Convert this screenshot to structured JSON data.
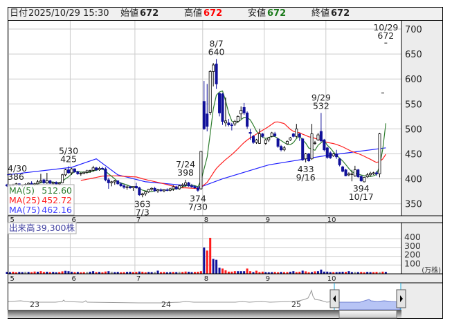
{
  "header": {
    "date_label": "日付",
    "date_value": "2025/10/29 15:30",
    "open_label": "始値",
    "open_value": "672",
    "high_label": "高値",
    "high_value": "672",
    "low_label": "安値",
    "low_value": "672",
    "close_label": "終値",
    "close_value": "672"
  },
  "legend": {
    "ma5_label": "MA(5)",
    "ma5_value": "512.60",
    "ma25_label": "MA(25)",
    "ma25_value": "452.72",
    "ma75_label": "MA(75)",
    "ma75_value": "462.16",
    "volume_label": "出来高",
    "volume_value": "39,300株"
  },
  "colors": {
    "up_fill": "#ffffff",
    "down_fill": "#10109a",
    "ma5": "#2e7d2e",
    "ma25": "#ff2020",
    "ma75": "#2020ff",
    "vol_red": "#ff1a1a",
    "vol_blue": "#10109a",
    "vol_gray": "#999999",
    "high_value": "#ff0000",
    "low_value": "#1a7a1a"
  },
  "navigator": {
    "year_labels": [
      "23",
      "24",
      "25"
    ]
  },
  "chart_data": {
    "type": "candlestick",
    "title": "",
    "price_axis": {
      "ylim": [
        330,
        720
      ],
      "ticks": [
        700,
        650,
        600,
        550,
        500,
        450,
        400,
        350
      ]
    },
    "month_ticks": [
      {
        "label": "5",
        "index": 1
      },
      {
        "label": "6",
        "index": 21
      },
      {
        "label": "7",
        "index": 42
      },
      {
        "label": "8",
        "index": 64
      },
      {
        "label": "9",
        "index": 84
      },
      {
        "label": "10",
        "index": 104
      }
    ],
    "ohlc": [
      [
        388,
        390,
        384,
        386
      ],
      [
        386,
        389,
        383,
        387
      ],
      [
        387,
        390,
        385,
        388
      ],
      [
        388,
        392,
        386,
        390
      ],
      [
        390,
        391,
        386,
        387
      ],
      [
        387,
        389,
        384,
        388
      ],
      [
        388,
        391,
        385,
        389
      ],
      [
        389,
        393,
        387,
        391
      ],
      [
        391,
        395,
        388,
        389
      ],
      [
        389,
        392,
        386,
        390
      ],
      [
        390,
        398,
        388,
        394
      ],
      [
        394,
        410,
        392,
        396
      ],
      [
        398,
        400,
        390,
        392
      ],
      [
        392,
        412,
        390,
        396
      ],
      [
        396,
        398,
        390,
        391
      ],
      [
        391,
        394,
        388,
        393
      ],
      [
        393,
        395,
        389,
        390
      ],
      [
        390,
        393,
        387,
        392
      ],
      [
        392,
        410,
        391,
        408
      ],
      [
        408,
        420,
        405,
        418
      ],
      [
        418,
        425,
        410,
        412
      ],
      [
        412,
        422,
        408,
        420
      ],
      [
        420,
        421,
        412,
        414
      ],
      [
        414,
        416,
        408,
        410
      ],
      [
        410,
        413,
        406,
        411
      ],
      [
        411,
        415,
        409,
        413
      ],
      [
        413,
        418,
        410,
        416
      ],
      [
        416,
        418,
        412,
        417
      ],
      [
        417,
        426,
        414,
        422
      ],
      [
        422,
        424,
        416,
        418
      ],
      [
        418,
        424,
        416,
        421
      ],
      [
        421,
        424,
        418,
        420
      ],
      [
        420,
        423,
        395,
        398
      ],
      [
        398,
        402,
        380,
        392
      ],
      [
        392,
        396,
        385,
        394
      ],
      [
        394,
        398,
        388,
        396
      ],
      [
        396,
        397,
        388,
        390
      ],
      [
        390,
        393,
        384,
        386
      ],
      [
        386,
        389,
        380,
        383
      ],
      [
        383,
        387,
        378,
        384
      ],
      [
        384,
        386,
        380,
        382
      ],
      [
        382,
        385,
        376,
        385
      ],
      [
        385,
        392,
        380,
        382
      ],
      [
        382,
        384,
        366,
        368
      ],
      [
        368,
        372,
        363,
        370
      ],
      [
        370,
        376,
        366,
        374
      ],
      [
        374,
        380,
        372,
        379
      ],
      [
        379,
        383,
        376,
        381
      ],
      [
        381,
        384,
        374,
        376
      ],
      [
        376,
        380,
        372,
        378
      ],
      [
        378,
        381,
        374,
        376
      ],
      [
        376,
        379,
        373,
        378
      ],
      [
        378,
        381,
        375,
        377
      ],
      [
        377,
        382,
        375,
        380
      ],
      [
        380,
        387,
        376,
        384
      ],
      [
        384,
        386,
        378,
        380
      ],
      [
        380,
        388,
        378,
        386
      ],
      [
        386,
        391,
        383,
        388
      ],
      [
        388,
        398,
        384,
        392
      ],
      [
        392,
        394,
        384,
        386
      ],
      [
        386,
        390,
        382,
        384
      ],
      [
        384,
        387,
        380,
        382
      ],
      [
        382,
        384,
        374,
        377
      ],
      [
        380,
        456,
        378,
        455
      ],
      [
        555,
        596,
        498,
        500
      ],
      [
        530,
        590,
        495,
        505
      ],
      [
        533,
        618,
        528,
        615
      ],
      [
        615,
        632,
        585,
        628
      ],
      [
        630,
        640,
        580,
        590
      ],
      [
        571,
        573,
        525,
        532
      ],
      [
        570,
        572,
        508,
        515
      ],
      [
        512,
        563,
        505,
        516
      ],
      [
        512,
        520,
        505,
        508
      ],
      [
        508,
        512,
        497,
        507
      ],
      [
        510,
        518,
        506,
        515
      ],
      [
        515,
        527,
        512,
        525
      ],
      [
        530,
        545,
        520,
        537
      ],
      [
        543,
        552,
        528,
        532
      ],
      [
        532,
        535,
        500,
        505
      ],
      [
        493,
        500,
        478,
        491
      ],
      [
        485,
        488,
        470,
        473
      ],
      [
        473,
        480,
        470,
        478
      ],
      [
        471,
        500,
        470,
        490
      ],
      [
        490,
        492,
        482,
        485
      ],
      [
        471,
        480,
        468,
        478
      ],
      [
        478,
        484,
        474,
        482
      ],
      [
        485,
        494,
        483,
        492
      ],
      [
        490,
        494,
        484,
        486
      ],
      [
        480,
        482,
        462,
        465
      ],
      [
        465,
        468,
        455,
        458
      ],
      [
        458,
        466,
        455,
        462
      ],
      [
        470,
        477,
        468,
        475
      ],
      [
        478,
        484,
        476,
        482
      ],
      [
        490,
        492,
        483,
        485
      ],
      [
        485,
        510,
        482,
        500
      ],
      [
        490,
        492,
        476,
        484
      ],
      [
        480,
        482,
        436,
        438
      ],
      [
        440,
        452,
        433,
        450
      ],
      [
        450,
        452,
        434,
        436
      ],
      [
        440,
        510,
        438,
        490
      ],
      [
        472,
        476,
        468,
        472
      ],
      [
        478,
        492,
        476,
        488
      ],
      [
        495,
        532,
        474,
        476
      ],
      [
        478,
        480,
        455,
        458
      ],
      [
        462,
        464,
        440,
        443
      ],
      [
        452,
        455,
        440,
        442
      ],
      [
        446,
        452,
        444,
        450
      ],
      [
        450,
        458,
        440,
        444
      ],
      [
        440,
        442,
        425,
        428
      ],
      [
        424,
        426,
        413,
        415
      ],
      [
        418,
        420,
        405,
        406
      ],
      [
        408,
        413,
        405,
        410
      ],
      [
        410,
        418,
        395,
        410
      ],
      [
        406,
        426,
        404,
        418
      ],
      [
        418,
        420,
        402,
        404
      ],
      [
        405,
        407,
        394,
        396
      ],
      [
        394,
        404,
        393,
        403
      ],
      [
        404,
        412,
        402,
        408
      ],
      [
        408,
        414,
        405,
        411
      ],
      [
        410,
        414,
        408,
        412
      ],
      [
        412,
        416,
        406,
        410
      ],
      [
        410,
        492,
        403,
        490
      ],
      [
        572,
        572,
        572,
        572
      ],
      [
        672,
        672,
        672,
        672
      ]
    ],
    "ma75_points": [
      [
        0,
        408
      ],
      [
        21,
        423
      ],
      [
        29,
        440
      ],
      [
        36,
        408
      ],
      [
        45,
        394
      ],
      [
        63,
        384
      ],
      [
        70,
        400
      ],
      [
        85,
        428
      ],
      [
        103,
        446
      ],
      [
        123,
        462
      ]
    ],
    "annotations": [
      {
        "index": 0,
        "date": "4/30",
        "price": "386",
        "pos": "above"
      },
      {
        "index": 20,
        "date": "5/30",
        "price": "425",
        "pos": "above"
      },
      {
        "index": 44,
        "date": "7/3",
        "price": "363",
        "pos": "below"
      },
      {
        "index": 58,
        "date": "7/24",
        "price": "398",
        "pos": "above"
      },
      {
        "index": 62,
        "date": "7/30",
        "price": "374",
        "pos": "below"
      },
      {
        "index": 68,
        "date": "8/7",
        "price": "640",
        "pos": "above"
      },
      {
        "index": 97,
        "date": "9/16",
        "price": "433",
        "pos": "below"
      },
      {
        "index": 102,
        "date": "9/29",
        "price": "532",
        "pos": "above"
      },
      {
        "index": 115,
        "date": "10/17",
        "price": "394",
        "pos": "below"
      },
      {
        "index": 123,
        "date": "10/29",
        "price": "672",
        "pos": "above"
      }
    ],
    "volume": {
      "unit_label": "(万株)",
      "ticks": [
        400,
        300,
        200,
        100
      ],
      "values": [
        22,
        20,
        24,
        18,
        22,
        20,
        24,
        22,
        20,
        26,
        24,
        30,
        22,
        24,
        20,
        22,
        18,
        20,
        28,
        34,
        30,
        24,
        20,
        22,
        18,
        20,
        22,
        24,
        30,
        20,
        22,
        18,
        26,
        30,
        24,
        20,
        22,
        18,
        20,
        22,
        24,
        20,
        22,
        26,
        24,
        18,
        22,
        20,
        22,
        36,
        20,
        22,
        18,
        20,
        22,
        20,
        24,
        22,
        26,
        24,
        20,
        22,
        24,
        30,
        300,
        265,
        410,
        170,
        160,
        70,
        60,
        40,
        25,
        25,
        30,
        30,
        30,
        30,
        60,
        30,
        20,
        35,
        20,
        25,
        20,
        18,
        20,
        22,
        18,
        22,
        20,
        20,
        24,
        30,
        20,
        24,
        36,
        28,
        18,
        20,
        28,
        30,
        48,
        25,
        25,
        20,
        20,
        20,
        22,
        24,
        22,
        30,
        20,
        22,
        20,
        22,
        18,
        22,
        20,
        20,
        22,
        20,
        25,
        22
      ],
      "colors": "bbrrbbgbrrbrrbrbbrrbbbrbrrgbbrbrrbgbbrrbbrrbrrbbgbrrbbrbgrrbbrrrbrrbbbrrrrrbbbrrbrrrbbbrrbrrbbrrbrrbrbbbbbrbbbrbbgbrrbbrrgrb"
    }
  }
}
